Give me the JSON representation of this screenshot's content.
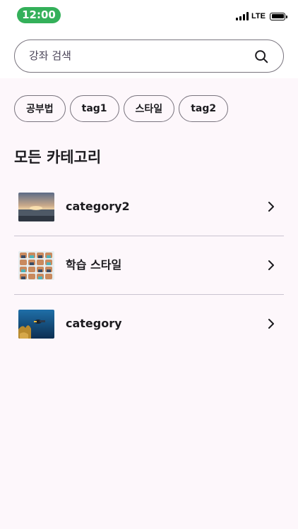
{
  "status_bar": {
    "time": "12:00",
    "network": "LTE"
  },
  "search": {
    "placeholder": "강좌 검색",
    "icon": "search-icon"
  },
  "tags": [
    {
      "label": "공부법"
    },
    {
      "label": "tag1"
    },
    {
      "label": "스타일"
    },
    {
      "label": "tag2"
    }
  ],
  "section": {
    "title": "모든 카테고리"
  },
  "categories": [
    {
      "label": "category2",
      "thumbnail": "sunset-beach-photo",
      "icon": "chevron-right-icon"
    },
    {
      "label": "학습 스타일",
      "thumbnail": "character-grid-illustration",
      "icon": "chevron-right-icon"
    },
    {
      "label": "category",
      "thumbnail": "scuba-diver-photo",
      "icon": "chevron-right-icon"
    }
  ],
  "colors": {
    "time_pill": "#34b05a",
    "background": "#fdf7fb",
    "outline": "#79747e",
    "divider": "#cac4d0",
    "text": "#1c1b1f"
  }
}
